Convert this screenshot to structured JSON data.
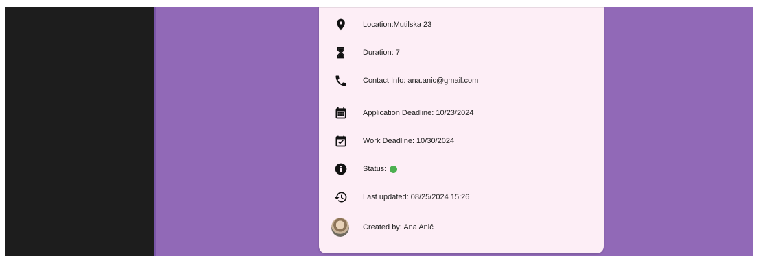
{
  "colors": {
    "sidebar": "#1d1d1d",
    "background": "#9169b7",
    "card": "#fdeef6",
    "status_active": "#4caf50"
  },
  "details": {
    "location": {
      "icon": "location-pin-icon",
      "text": "Location:Mutilska 23"
    },
    "duration": {
      "icon": "hourglass-icon",
      "text": "Duration: 7"
    },
    "contact": {
      "icon": "phone-icon",
      "text": "Contact Info: ana.anic@gmail.com"
    },
    "application_deadline": {
      "icon": "calendar-icon",
      "text": "Application Deadline: 10/23/2024"
    },
    "work_deadline": {
      "icon": "calendar-check-icon",
      "text": "Work Deadline: 10/30/2024"
    },
    "status": {
      "icon": "info-icon",
      "text": "Status:",
      "color": "#4caf50"
    },
    "last_updated": {
      "icon": "history-icon",
      "text": "Last updated: 08/25/2024 15:26"
    },
    "created_by": {
      "icon": "avatar",
      "text": "Created by: Ana Anić"
    }
  }
}
